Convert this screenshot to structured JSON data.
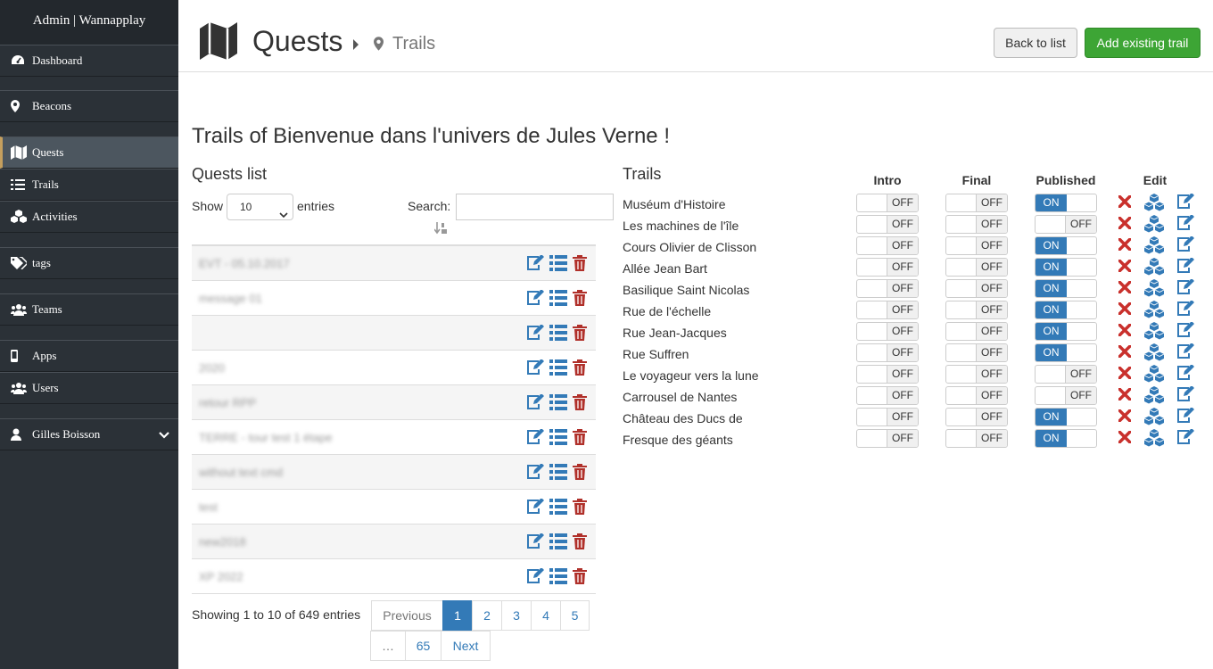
{
  "sidebar": {
    "brand": "Admin | Wannapplay",
    "items": [
      {
        "label": "Dashboard",
        "icon": "dashboard-icon"
      },
      {
        "label": "Beacons",
        "icon": "map-marker-icon"
      },
      {
        "label": "Quests",
        "icon": "map-icon",
        "active": true
      },
      {
        "label": "Trails",
        "icon": "list-icon"
      },
      {
        "label": "Activities",
        "icon": "cubes-icon"
      },
      {
        "label": "tags",
        "icon": "tags-icon"
      },
      {
        "label": "Teams",
        "icon": "users-icon"
      },
      {
        "label": "Apps",
        "icon": "mobile-icon"
      },
      {
        "label": "Users",
        "icon": "users-icon"
      },
      {
        "label": "Gilles Boisson",
        "icon": "user-icon"
      }
    ]
  },
  "header": {
    "title": "Quests",
    "subtitle": "Trails",
    "back_label": "Back to list",
    "add_label": "Add existing trail"
  },
  "page": {
    "heading": "Trails of Bienvenue dans l'univers de Jules Verne !"
  },
  "quests": {
    "title": "Quests list",
    "show_label": "Show",
    "show_value": "10",
    "entries_label": "entries",
    "search_label": "Search:",
    "rows": [
      {
        "name": "EVT - 05.10.2017"
      },
      {
        "name": "message 01"
      },
      {
        "name": ""
      },
      {
        "name": "2020"
      },
      {
        "name": "retour RPP"
      },
      {
        "name": "TERRE - tour test 1 étape"
      },
      {
        "name": "without text cmd"
      },
      {
        "name": "test"
      },
      {
        "name": "new2018"
      },
      {
        "name": "XP 2022"
      }
    ],
    "info": "Showing 1 to 10 of 649 entries",
    "pager": {
      "previous": "Previous",
      "pages": [
        "1",
        "2",
        "3",
        "4",
        "5"
      ],
      "ellipsis": "…",
      "last": "65",
      "next": "Next",
      "current": "1"
    }
  },
  "trails": {
    "title": "Trails",
    "columns": {
      "intro": "Intro",
      "final": "Final",
      "published": "Published",
      "edit": "Edit"
    },
    "on_label": "ON",
    "off_label": "OFF",
    "rows": [
      {
        "name": "Muséum d'Histoire",
        "intro": false,
        "final": false,
        "published": true
      },
      {
        "name": "Les machines de l'île",
        "intro": false,
        "final": false,
        "published": false
      },
      {
        "name": "Cours Olivier de Clisson",
        "intro": false,
        "final": false,
        "published": true
      },
      {
        "name": "Allée Jean Bart",
        "intro": false,
        "final": false,
        "published": true
      },
      {
        "name": "Basilique Saint Nicolas",
        "intro": false,
        "final": false,
        "published": true
      },
      {
        "name": "Rue de l'échelle",
        "intro": false,
        "final": false,
        "published": true
      },
      {
        "name": "Rue Jean-Jacques",
        "intro": false,
        "final": false,
        "published": true
      },
      {
        "name": "Rue Suffren",
        "intro": false,
        "final": false,
        "published": true
      },
      {
        "name": "Le voyageur vers la lune",
        "intro": false,
        "final": false,
        "published": false
      },
      {
        "name": "Carrousel de Nantes",
        "intro": false,
        "final": false,
        "published": false
      },
      {
        "name": "Château des Ducs de",
        "intro": false,
        "final": false,
        "published": true
      },
      {
        "name": "Fresque des géants",
        "intro": false,
        "final": false,
        "published": true
      }
    ]
  },
  "colors": {
    "sidebar_bg": "#2b3137",
    "primary": "#337ab7",
    "success": "#3da535",
    "danger": "#b0302a"
  }
}
